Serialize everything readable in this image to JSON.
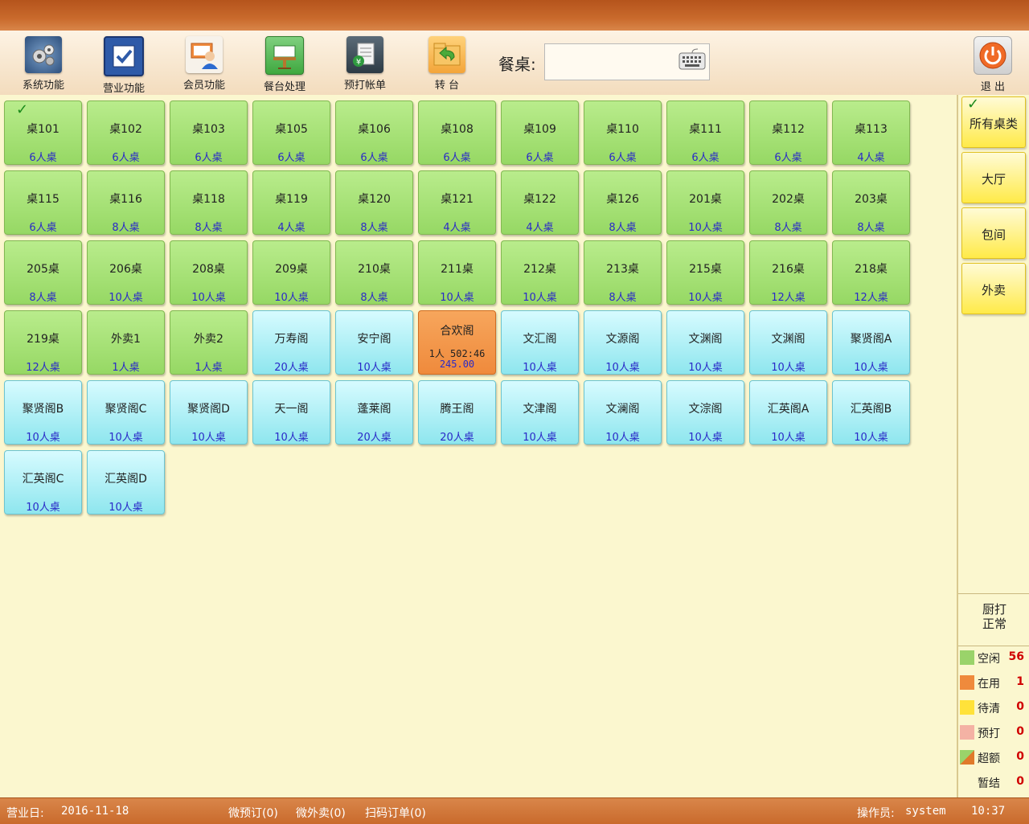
{
  "toolbar": {
    "tools": [
      {
        "label": "系统功能",
        "icon": "gears-icon"
      },
      {
        "label": "营业功能",
        "icon": "checkbox-icon"
      },
      {
        "label": "会员功能",
        "icon": "member-icon"
      },
      {
        "label": "餐台处理",
        "icon": "dining-table-icon"
      },
      {
        "label": "预打帐单",
        "icon": "receipt-icon"
      },
      {
        "label": "转 台",
        "icon": "transfer-folder-icon"
      }
    ],
    "table_label": "餐桌:",
    "table_value": "",
    "exit_label": "退 出"
  },
  "tables": [
    {
      "name": "桌101",
      "seats": "6人桌",
      "state": "idle",
      "checked": "✓"
    },
    {
      "name": "桌102",
      "seats": "6人桌",
      "state": "idle"
    },
    {
      "name": "桌103",
      "seats": "6人桌",
      "state": "idle"
    },
    {
      "name": "桌105",
      "seats": "6人桌",
      "state": "idle"
    },
    {
      "name": "桌106",
      "seats": "6人桌",
      "state": "idle"
    },
    {
      "name": "桌108",
      "seats": "6人桌",
      "state": "idle"
    },
    {
      "name": "桌109",
      "seats": "6人桌",
      "state": "idle"
    },
    {
      "name": "桌110",
      "seats": "6人桌",
      "state": "idle"
    },
    {
      "name": "桌111",
      "seats": "6人桌",
      "state": "idle"
    },
    {
      "name": "桌112",
      "seats": "6人桌",
      "state": "idle"
    },
    {
      "name": "桌113",
      "seats": "4人桌",
      "state": "idle"
    },
    {
      "name": "桌115",
      "seats": "6人桌",
      "state": "idle"
    },
    {
      "name": "桌116",
      "seats": "8人桌",
      "state": "idle"
    },
    {
      "name": "桌118",
      "seats": "8人桌",
      "state": "idle"
    },
    {
      "name": "桌119",
      "seats": "4人桌",
      "state": "idle"
    },
    {
      "name": "桌120",
      "seats": "8人桌",
      "state": "idle"
    },
    {
      "name": "桌121",
      "seats": "4人桌",
      "state": "idle"
    },
    {
      "name": "桌122",
      "seats": "4人桌",
      "state": "idle"
    },
    {
      "name": "桌126",
      "seats": "8人桌",
      "state": "idle"
    },
    {
      "name": "201桌",
      "seats": "10人桌",
      "state": "idle"
    },
    {
      "name": "202桌",
      "seats": "8人桌",
      "state": "idle"
    },
    {
      "name": "203桌",
      "seats": "8人桌",
      "state": "idle"
    },
    {
      "name": "205桌",
      "seats": "8人桌",
      "state": "idle"
    },
    {
      "name": "206桌",
      "seats": "10人桌",
      "state": "idle"
    },
    {
      "name": "208桌",
      "seats": "10人桌",
      "state": "idle"
    },
    {
      "name": "209桌",
      "seats": "10人桌",
      "state": "idle"
    },
    {
      "name": "210桌",
      "seats": "8人桌",
      "state": "idle"
    },
    {
      "name": "211桌",
      "seats": "10人桌",
      "state": "idle"
    },
    {
      "name": "212桌",
      "seats": "10人桌",
      "state": "idle"
    },
    {
      "name": "213桌",
      "seats": "8人桌",
      "state": "idle"
    },
    {
      "name": "215桌",
      "seats": "10人桌",
      "state": "idle"
    },
    {
      "name": "216桌",
      "seats": "12人桌",
      "state": "idle"
    },
    {
      "name": "218桌",
      "seats": "12人桌",
      "state": "idle"
    },
    {
      "name": "219桌",
      "seats": "12人桌",
      "state": "idle"
    },
    {
      "name": "外卖1",
      "seats": "1人桌",
      "state": "idle"
    },
    {
      "name": "外卖2",
      "seats": "1人桌",
      "state": "idle"
    },
    {
      "name": "万寿阁",
      "seats": "20人桌",
      "state": "room"
    },
    {
      "name": "安宁阁",
      "seats": "10人桌",
      "state": "room"
    },
    {
      "name": "合欢阁",
      "status": "1人 502:46",
      "amount": "245.00",
      "state": "inuse"
    },
    {
      "name": "文汇阁",
      "seats": "10人桌",
      "state": "room"
    },
    {
      "name": "文源阁",
      "seats": "10人桌",
      "state": "room"
    },
    {
      "name": "文渊阁",
      "seats": "10人桌",
      "state": "room"
    },
    {
      "name": "文渊阁",
      "seats": "10人桌",
      "state": "room"
    },
    {
      "name": "聚贤阁A",
      "seats": "10人桌",
      "state": "room"
    },
    {
      "name": "聚贤阁B",
      "seats": "10人桌",
      "state": "room"
    },
    {
      "name": "聚贤阁C",
      "seats": "10人桌",
      "state": "room"
    },
    {
      "name": "聚贤阁D",
      "seats": "10人桌",
      "state": "room"
    },
    {
      "name": "天一阁",
      "seats": "10人桌",
      "state": "room"
    },
    {
      "name": "蓬莱阁",
      "seats": "20人桌",
      "state": "room"
    },
    {
      "name": "腾王阁",
      "seats": "20人桌",
      "state": "room"
    },
    {
      "name": "文津阁",
      "seats": "10人桌",
      "state": "room"
    },
    {
      "name": "文澜阁",
      "seats": "10人桌",
      "state": "room"
    },
    {
      "name": "文淙阁",
      "seats": "10人桌",
      "state": "room"
    },
    {
      "name": "汇英阁A",
      "seats": "10人桌",
      "state": "room"
    },
    {
      "name": "汇英阁B",
      "seats": "10人桌",
      "state": "room"
    },
    {
      "name": "汇英阁C",
      "seats": "10人桌",
      "state": "room"
    },
    {
      "name": "汇英阁D",
      "seats": "10人桌",
      "state": "room"
    }
  ],
  "categories": [
    {
      "label": "所有桌类",
      "checked": "✓"
    },
    {
      "label": "大厅"
    },
    {
      "label": "包间"
    },
    {
      "label": "外卖"
    }
  ],
  "kitchen": {
    "line1": "厨打",
    "line2": "正常"
  },
  "legend": [
    {
      "label": "空闲",
      "count": "56",
      "color": "#9ad36a"
    },
    {
      "label": "在用",
      "count": "1",
      "color": "#ef8a3c"
    },
    {
      "label": "待清",
      "count": "0",
      "color": "#ffe23a"
    },
    {
      "label": "预打",
      "count": "0",
      "color": "#f4b2a4"
    },
    {
      "label": "超额",
      "count": "0",
      "color": "#e07a2a"
    },
    {
      "label": "暂结",
      "count": "0",
      "color": ""
    }
  ],
  "status": {
    "business_day_label": "营业日:",
    "business_day": "2016-11-18",
    "wx_preorder": "微预订(0)",
    "wx_takeout": "微外卖(0)",
    "scan_order": "扫码订单(0)",
    "operator_label": "操作员:",
    "operator": "system",
    "time": "10:37"
  },
  "colors": {
    "idle": "#9ad36a",
    "room": "#8ee6ee",
    "inuse": "#ef8a3c",
    "accent": "#c96a2c"
  }
}
